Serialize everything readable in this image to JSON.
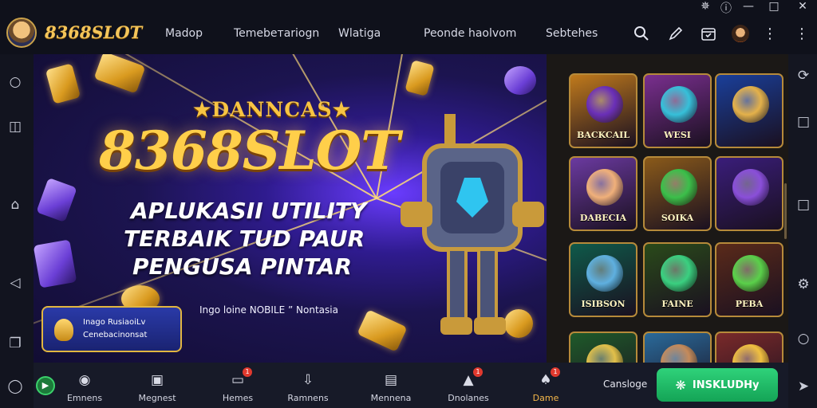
{
  "header": {
    "brand": "8368SLOT",
    "nav": [
      "Madop",
      "Temebeтariogn",
      "Wlatiga",
      "Peonde haolvom",
      "Sebtehes"
    ],
    "icons": [
      "search-icon",
      "edit-icon",
      "calendar-icon",
      "avatar",
      "more-vert-icon",
      "more-vert-icon"
    ],
    "window_controls": [
      "minimize",
      "maximize",
      "close"
    ]
  },
  "left_rail": {
    "icons": [
      "circle-icon",
      "window-icon",
      "home-icon",
      "back-icon",
      "copy-icon",
      "logo-icon"
    ]
  },
  "right_rail": {
    "icons": [
      "refresh-icon",
      "square-icon",
      "square-icon",
      "settings-icon",
      "circle-icon",
      "navigate-icon"
    ]
  },
  "banner": {
    "subtitle": "DANNCAS",
    "title": "8368SLOT",
    "lines": [
      "APLUKASII UTILITY",
      "TERBAIK TUD PAUR",
      "PENGUSA PINTAR"
    ],
    "caption": "Ingo loine NOBILE ” Nontasia",
    "promo": {
      "line1": "Inago RusiaoiLv",
      "line2": "Cenebacinonsat"
    }
  },
  "games": [
    {
      "label": "BACKCAIL",
      "color": "#c07a1c",
      "art": "#6a2fb8"
    },
    {
      "label": "WESI",
      "color": "#7a2f8f",
      "art": "#36c0d9"
    },
    {
      "label": "",
      "color": "#1a3f9a",
      "art": "#e4b14a"
    },
    {
      "label": "DABECIA",
      "color": "#6b3aa0",
      "art": "#f0b07a"
    },
    {
      "label": "SOIKA",
      "color": "#8a5a1a",
      "art": "#3bbf4a"
    },
    {
      "label": "",
      "color": "#3a1d7a",
      "art": "#8a4fd9"
    },
    {
      "label": "ISIBSON",
      "color": "#0f5a4a",
      "art": "#5fb0e0"
    },
    {
      "label": "FAINE",
      "color": "#2a4a1a",
      "art": "#3ad080"
    },
    {
      "label": "PEBA",
      "color": "#5a2a1a",
      "art": "#5ad04a"
    },
    {
      "label": "",
      "color": "#1f5a2a",
      "art": "#e2c04a"
    },
    {
      "label": "",
      "color": "#2a6a9a",
      "art": "#c58a5a"
    },
    {
      "label": "",
      "color": "#7a2a2a",
      "art": "#f0c040"
    }
  ],
  "bottom_nav": [
    {
      "label": "Emnens",
      "icon": "disc-icon",
      "badge": ""
    },
    {
      "label": "Megnest",
      "icon": "image-icon",
      "badge": ""
    },
    {
      "label": "Hemes",
      "icon": "folder-icon",
      "badge": "1"
    },
    {
      "label": "Ramnens",
      "icon": "download-icon",
      "badge": ""
    },
    {
      "label": "Mennena",
      "icon": "card-icon",
      "badge": ""
    },
    {
      "label": "Dnolanes",
      "icon": "triangle-icon",
      "badge": "1"
    },
    {
      "label": "Dame",
      "icon": "game-icon",
      "badge": "1",
      "active": true
    }
  ],
  "footer": {
    "catalog_label": "Cansloge",
    "install_label": "INSKLUDHy"
  },
  "colors": {
    "accent_gold": "#f4c55a",
    "install_green": "#1fbf67",
    "active_tab": "#f5b74a"
  }
}
